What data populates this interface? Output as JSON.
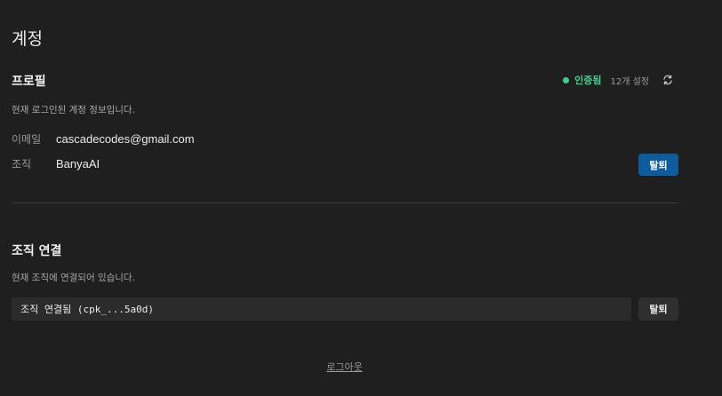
{
  "page": {
    "title": "계정"
  },
  "profile": {
    "title": "프로필",
    "description": "현재 로그인된 계정 정보입니다.",
    "status_label": "인증됨",
    "status_color": "#3ecf8e",
    "settings_count": "12개 설정",
    "refresh_icon": "refresh-icon",
    "email_label": "이메일",
    "email_value": "cascadecodes@gmail.com",
    "org_label": "조직",
    "org_value": "BanyaAI",
    "leave_button": "탈퇴",
    "leave_button_color": "#0d5d9e"
  },
  "org_connection": {
    "title": "조직 연결",
    "description": "현재 조직에 연결되어 있습니다.",
    "connection_status": "조직 연결됨 (cpk_...5a0d)",
    "leave_button": "탈퇴"
  },
  "footer": {
    "logout_label": "로그아웃"
  }
}
